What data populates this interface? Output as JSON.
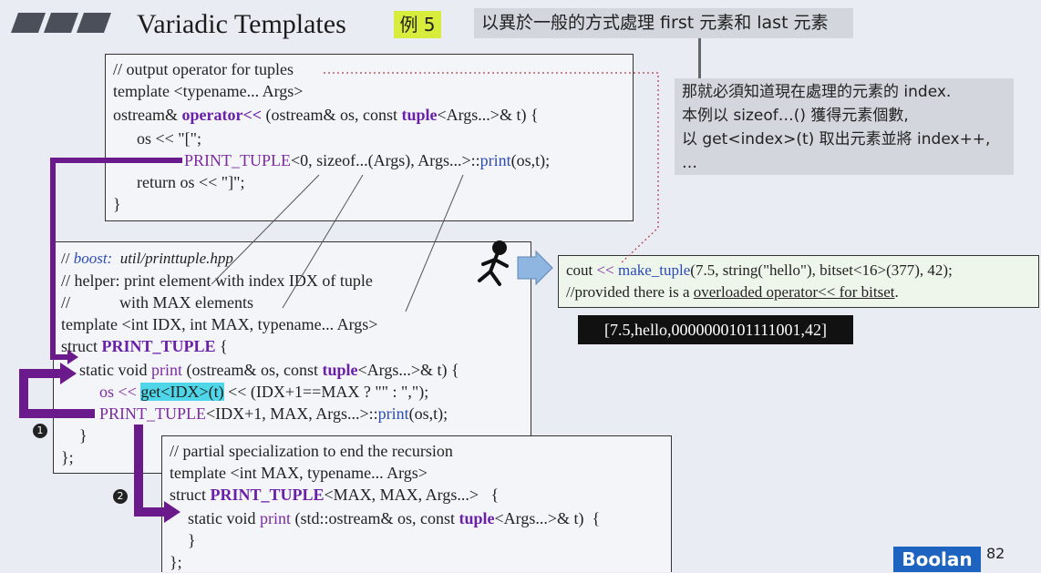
{
  "header": {
    "title": "Variadic Templates",
    "badge": "例 5",
    "note": "以異於一般的方式處理 first 元素和 last 元素"
  },
  "side_note": [
    "那就必須知道現在處理的元素的 index.",
    "本例以 sizeof…() 獲得元素個數,",
    "以 get<index>(t) 取出元素並將 index++,",
    "…"
  ],
  "box1": {
    "l1": "// output operator for tuples",
    "l2": "template <typename... Args>",
    "l3a": "ostream& ",
    "l3b": "operator<<",
    "l3c": " (ostream& os, const ",
    "l3d": "tuple",
    "l3e": "<Args...>& t) {",
    "l4": "os << \"[\";",
    "l5a": "PRINT_TUPLE",
    "l5b": "<0, sizeof...(Args), Args...>::",
    "l5c": "print",
    "l5d": "(os,t);",
    "l6": "return os << \"]\";",
    "l7": "}"
  },
  "box2": {
    "l1a": "// ",
    "l1b": "boost:",
    "l1c": "  util/printtuple.hpp",
    "l2": "// helper: print element with index IDX of tuple",
    "l3": "//            with MAX elements",
    "l4": "template <int IDX, int MAX, typename... Args>",
    "l5a": "struct ",
    "l5b": "PRINT_TUPLE",
    "l5c": " {",
    "l6a": "static void ",
    "l6b": "print",
    "l6c": " (ostream& os, const ",
    "l6d": "tuple",
    "l6e": "<Args...>& t) {",
    "l7a": "os << ",
    "l7b": "get<IDX>(t)",
    "l7c": " << (IDX+1==MAX ? \"\" : \",\");",
    "l8a": "PRINT_TUPLE",
    "l8b": "<IDX+1, MAX, Args...>::",
    "l8c": "print",
    "l8d": "(os,t);",
    "l9": "}",
    "l10": "};"
  },
  "box3": {
    "l1": "// partial specialization to end the recursion",
    "l2": "template <int MAX, typename... Args>",
    "l3a": "struct ",
    "l3b": "PRINT_TUPLE",
    "l3c": "<MAX, MAX, Args...>   {",
    "l4a": "static void ",
    "l4b": "print",
    "l4c": " (std::ostream& os, const ",
    "l4d": "tuple",
    "l4e": "<Args...>& t)  {",
    "l5": "}",
    "l6": "};"
  },
  "example": {
    "l1a": "cout ",
    "l1b": "<<",
    "l1c": " make_tuple",
    "l1d": "(7.5, string(\"hello\"), bitset<16>(377), 42);",
    "l2a": "//provided there is a ",
    "l2b": "overloaded operator<< for bitset",
    "l2c": "."
  },
  "output": "[7.5,hello,0000000101111001,42]",
  "markers": [
    "1",
    "2"
  ],
  "logo": "Boolan",
  "page_number": "82",
  "colors": {
    "keyword": "#6a1fa8",
    "function": "#2a4bb5",
    "arrow": "#6b1a8c",
    "badge": "#d8ec3c",
    "highlight": "#4fd6e8"
  }
}
